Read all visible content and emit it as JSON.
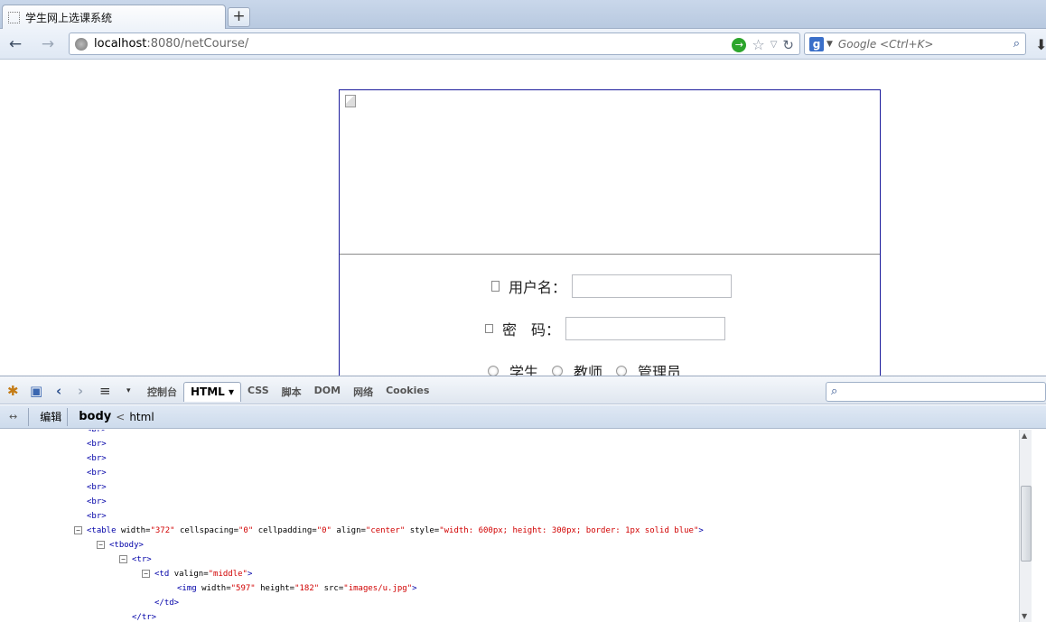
{
  "browser": {
    "tab_title": "学生网上选课系统",
    "new_tab_label": "+",
    "url_host": "localhost",
    "url_rest": ":8080/netCourse/",
    "search_placeholder": "Google <Ctrl+K>"
  },
  "page": {
    "user_label": "用户名：",
    "pass_label": "密　码：",
    "roles": [
      "学生",
      "教师",
      "管理员"
    ]
  },
  "firebug": {
    "tabs": [
      "控制台",
      "HTML ▾",
      "CSS",
      "脚本",
      "DOM",
      "网络",
      "Cookies"
    ],
    "active_tab": "HTML ▾",
    "edit_label": "编辑",
    "bread_current": "body",
    "bread_lt": "<",
    "bread_parent": "html",
    "html_lines": [
      {
        "text": "<br>"
      },
      {
        "text": "<br>"
      },
      {
        "text": "<br>"
      },
      {
        "text": "<br>"
      },
      {
        "text": "<br>"
      },
      {
        "text": "<br>"
      },
      {
        "text": "<br>"
      }
    ],
    "table_tag": "<table",
    "table_attrs": [
      {
        "name": "width",
        "value": "372"
      },
      {
        "name": "cellspacing",
        "value": "0"
      },
      {
        "name": "cellpadding",
        "value": "0"
      },
      {
        "name": "align",
        "value": "center"
      },
      {
        "name": "style",
        "value": "width: 600px; height: 300px; border: 1px solid blue"
      }
    ],
    "tbody": "<tbody>",
    "tr": "<tr>",
    "td_tag": "<td",
    "td_attr_name": "valign",
    "td_attr_value": "middle",
    "img_tag": "<img",
    "img_attrs": [
      {
        "name": "width",
        "value": "597"
      },
      {
        "name": "height",
        "value": "182"
      },
      {
        "name": "src",
        "value": "images/u.jpg"
      }
    ],
    "td_close": "</td>",
    "tr_close": "</tr>"
  }
}
